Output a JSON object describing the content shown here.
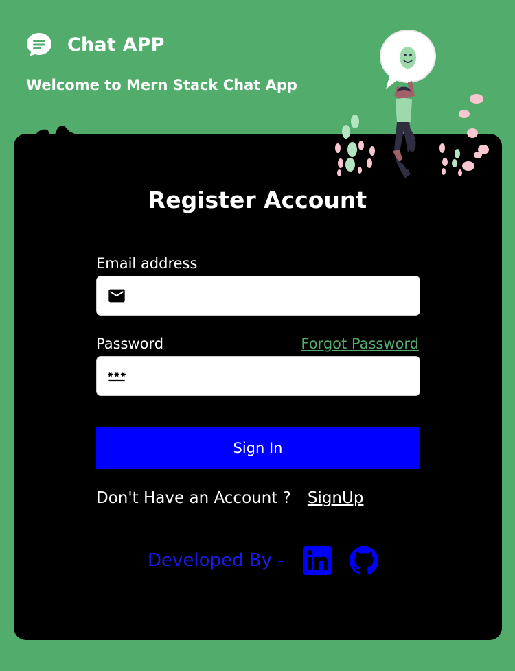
{
  "app": {
    "title": "Chat APP",
    "welcome": "Welcome to Mern Stack Chat App"
  },
  "form": {
    "heading": "Register Account",
    "email_label": "Email address",
    "email_value": "",
    "password_label": "Password",
    "password_value": "",
    "forgot_link": "Forgot Password",
    "submit_label": "Sign In"
  },
  "footer": {
    "account_prompt": "Don't Have an Account ?",
    "signup_link": "SignUp",
    "developed_by": "Developed By -"
  },
  "icons": {
    "brand": "chat-bubble-icon",
    "email": "mail-icon",
    "password": "password-icon",
    "linkedin": "linkedin-icon",
    "github": "github-icon"
  },
  "colors": {
    "background": "#52ad6d",
    "card": "#000000",
    "primary_button": "#0000ff",
    "link_green": "#52ad6d",
    "developer_text": "#1a1ae6"
  }
}
